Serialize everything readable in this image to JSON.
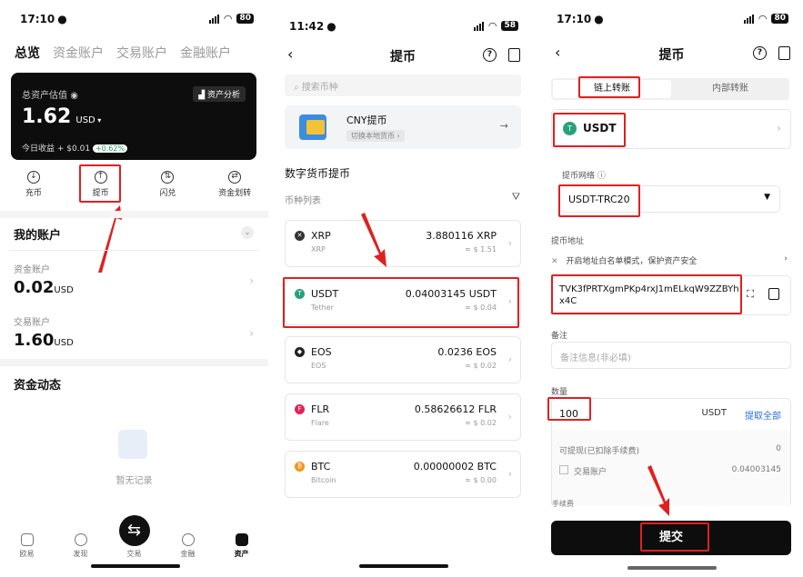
{
  "p1": {
    "time": "17:10",
    "battery": "80",
    "tabs": [
      "总览",
      "资金账户",
      "交易账户",
      "金融账户"
    ],
    "card": {
      "est_label": "总资产估值",
      "analysis": "资产分析",
      "amount": "1.62",
      "currency": "USD",
      "today_label": "今日收益",
      "today_value": "+ $0.01",
      "today_pct": "+0.62%"
    },
    "actions": [
      "充币",
      "提币",
      "闪兑",
      "资金划转"
    ],
    "my_accounts": "我的账户",
    "fund_label": "资金账户",
    "fund_value": "0.02",
    "fund_unit": "USD",
    "trade_label": "交易账户",
    "trade_value": "1.60",
    "trade_unit": "USD",
    "dynamics": "资金动态",
    "empty": "暂无记录",
    "nav": [
      "欧易",
      "发现",
      "交易",
      "金融",
      "资产"
    ]
  },
  "p2": {
    "time": "11:42",
    "battery": "58",
    "title": "提币",
    "search_placeholder": "搜索币种",
    "cny_title": "CNY提币",
    "cny_sub": "切换本地货币",
    "section": "数字货币提币",
    "list_label": "币种列表",
    "coins": [
      {
        "sym": "XRP",
        "name": "XRP",
        "amount": "3.880116 XRP",
        "usd": "≈ $ 1.51",
        "color": "#333",
        "glyph": "✕"
      },
      {
        "sym": "USDT",
        "name": "Tether",
        "amount": "0.04003145 USDT",
        "usd": "≈ $ 0.04",
        "color": "#26a17b",
        "glyph": "T"
      },
      {
        "sym": "EOS",
        "name": "EOS",
        "amount": "0.0236 EOS",
        "usd": "≈ $ 0.02",
        "color": "#222",
        "glyph": "◆"
      },
      {
        "sym": "FLR",
        "name": "Flare",
        "amount": "0.58626612 FLR",
        "usd": "≈ $ 0.02",
        "color": "#e62058",
        "glyph": "F"
      },
      {
        "sym": "BTC",
        "name": "Bitcoin",
        "amount": "0.00000002 BTC",
        "usd": "≈ $ 0.00",
        "color": "#f7931a",
        "glyph": "₿"
      }
    ]
  },
  "p3": {
    "time": "17:10",
    "battery": "80",
    "title": "提币",
    "seg_onchain": "链上转账",
    "seg_internal": "内部转账",
    "coin": "USDT",
    "network_label": "提币网络",
    "network": "USDT-TRC20",
    "address_label": "提币地址",
    "whitelist": "开启地址白名单模式，保护资产安全",
    "address": "TVK3fPRTXgmPKp4rxJ1mELkqW9ZZBYhx4C",
    "memo_label": "备注",
    "memo_placeholder": "备注信息(非必填)",
    "qty_label": "数量",
    "qty": "100",
    "qty_unit": "USDT",
    "withdraw_all": "提取全部",
    "available_label": "可提现(已扣除手续费)",
    "available_value": "0",
    "trade_acct": "交易账户",
    "trade_value": "0.04003145",
    "fee_label": "手续费",
    "submit": "提交"
  }
}
